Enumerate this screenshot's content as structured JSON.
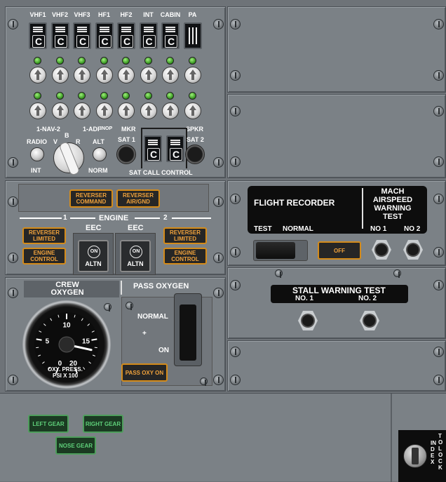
{
  "audio_panel": {
    "call_labels": [
      "VHF1",
      "VHF2",
      "VHF3",
      "HF1",
      "HF2",
      "INT",
      "CABIN",
      "PA"
    ],
    "call_switch_letter": "C",
    "row2_labels": [
      "1-NAV-2",
      "1-ADF",
      "INOP",
      "MKR",
      "SPKR"
    ],
    "radio_label": "RADIO",
    "int_label": "INT",
    "selector_letters": [
      "V",
      "B",
      "R"
    ],
    "alt_label": "ALT",
    "norm_label": "NORM",
    "sat1_label": "SAT 1",
    "sat2_label": "SAT 2",
    "sat_call_label": "SAT CALL CONTROL"
  },
  "engine_panel": {
    "reverser_command": "REVERSER COMMAND",
    "reverser_airgnd": "REVERSER AIR/GND",
    "engine_label": "ENGINE",
    "engine_1": "1",
    "engine_2": "2",
    "eec_label": "EEC",
    "reverser_limited": "REVERSER LIMITED",
    "engine_control": "ENGINE CONTROL",
    "on_label": "ON",
    "altn_label": "ALTN"
  },
  "oxygen_panel": {
    "crew_oxygen": "CREW OXYGEN",
    "pass_oxygen": "PASS OXYGEN",
    "normal_label": "NORMAL",
    "plus_label": "+",
    "on_label": "ON",
    "pass_oxy_on": "PASS OXY ON",
    "gauge_ticks": [
      "0",
      "5",
      "10",
      "15",
      "20"
    ],
    "gauge_caption_1": "OXY. PRESS.",
    "gauge_caption_2": "PSI X 100",
    "gauge_value_fraction": 0.82
  },
  "flight_recorder_panel": {
    "flight_recorder": "FLIGHT RECORDER",
    "mach_title": "MACH AIRSPEED WARNING TEST",
    "test_label": "TEST",
    "normal_label": "NORMAL",
    "no1": "NO 1",
    "no2": "NO 2",
    "off_label": "OFF"
  },
  "stall_panel": {
    "title": "STALL WARNING TEST",
    "no1": "NO. 1",
    "no2": "NO. 2"
  },
  "gear_panel": {
    "left_gear": "LEFT GEAR",
    "right_gear": "RIGHT GEAR",
    "nose_gear": "NOSE GEAR",
    "index": "INDEX",
    "to_lock": "TO LOCK"
  },
  "colors": {
    "amber": "#f0a23c",
    "green": "#5fd07a",
    "panel": "#7b8186"
  }
}
